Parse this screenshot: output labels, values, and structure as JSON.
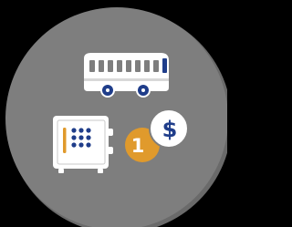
{
  "icon": {
    "background_color": "#000000",
    "disc_color": "#7e7e7e",
    "disc_shadow_color": "#6a6a6a",
    "glyph_color": "#ffffff",
    "accent_blue": "#1f3d8a",
    "accent_orange": "#e09a2c",
    "shade_gray": "#c9c9c9",
    "bus": {
      "name": "bus-icon"
    },
    "safe": {
      "name": "safe-icon",
      "dial_dots": 9
    },
    "coins": {
      "name": "coins-icon",
      "front_label": "$",
      "back_label": "1"
    }
  }
}
